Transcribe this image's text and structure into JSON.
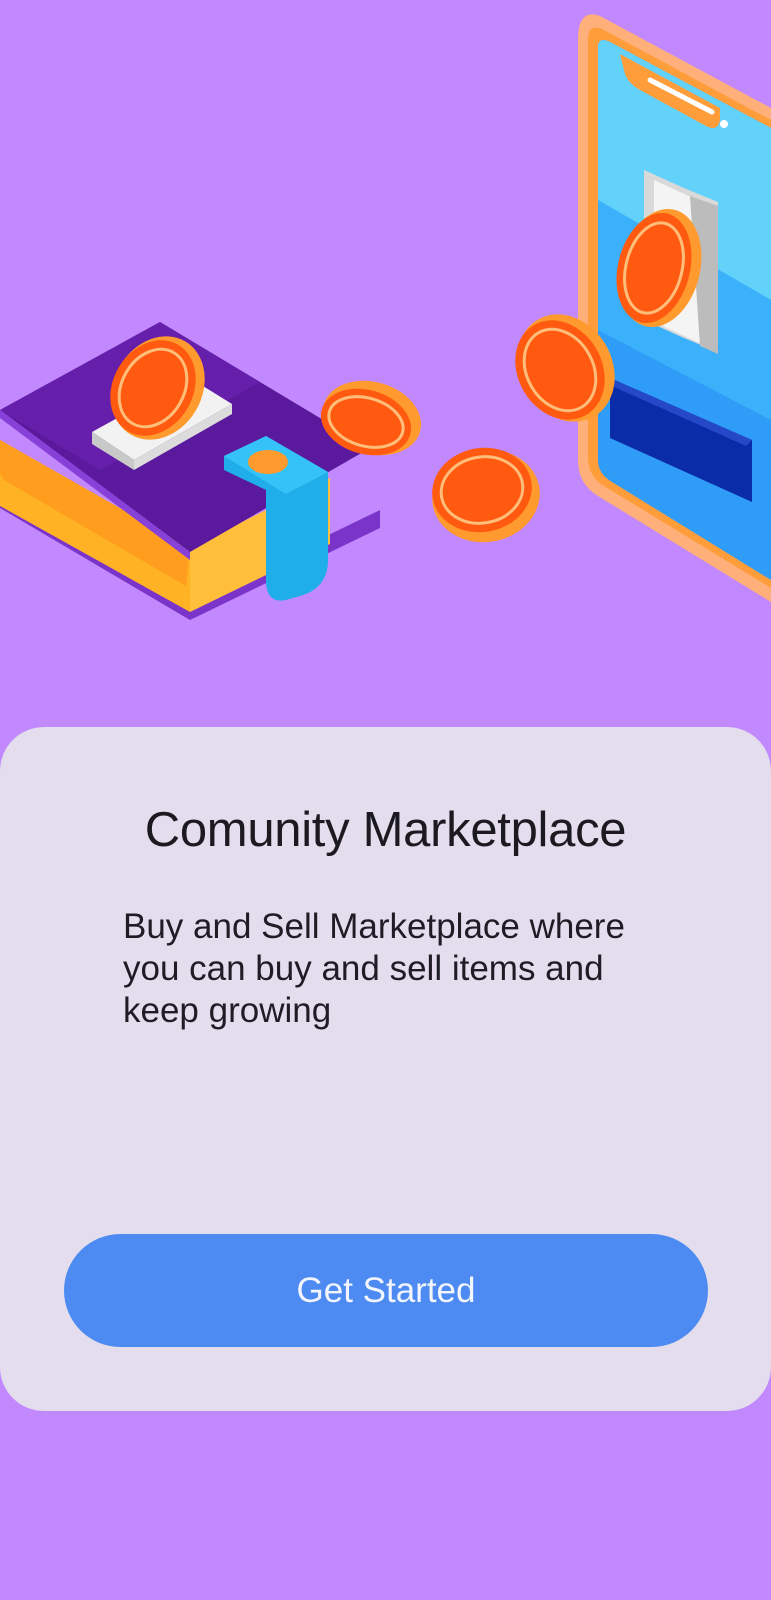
{
  "onboarding": {
    "title": "Comunity Marketplace",
    "description": "Buy and Sell Marketplace where you can buy and sell items and keep growing",
    "cta_label": "Get Started"
  },
  "colors": {
    "background": "#c288fd",
    "card": "#e3dded",
    "button": "#4d8bf2",
    "coin": "#ff5a0f"
  },
  "illustration": {
    "icons": [
      "wallet-icon",
      "coin-icon",
      "smartphone-icon"
    ]
  }
}
